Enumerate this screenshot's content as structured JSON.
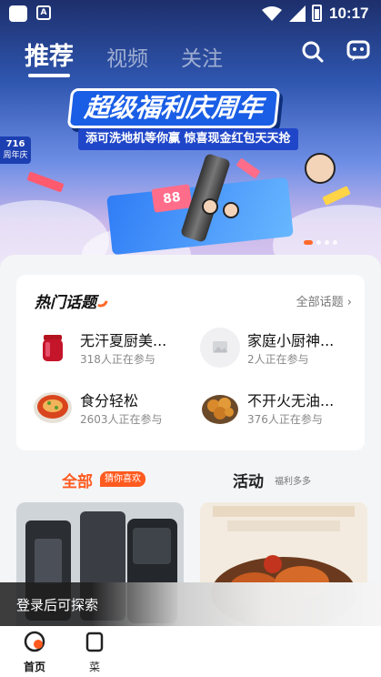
{
  "status_bar": {
    "time": "10:17",
    "app_badge": "A"
  },
  "header": {
    "tabs": [
      {
        "label": "推荐",
        "active": true
      },
      {
        "label": "视频",
        "active": false
      },
      {
        "label": "关注",
        "active": false
      }
    ],
    "search_icon": "search-icon",
    "message_icon": "chat-robot-icon"
  },
  "banner": {
    "title": "超级福利庆周年",
    "subtitle": "添可洗地机等你赢 惊喜现金红包天天抢",
    "badge": [
      "716",
      "周年庆"
    ],
    "card_text": "88"
  },
  "hot_topics": {
    "title": "热门话题",
    "more_label": "全部话题",
    "items": [
      {
        "name": "无汗夏厨美...",
        "count": "318人正在参与",
        "thumb": "jam-jar"
      },
      {
        "name": "家庭小厨神...",
        "count": "2人正在参与",
        "thumb": "image-placeholder"
      },
      {
        "name": "食分轻松",
        "count": "2603人正在参与",
        "thumb": "noodle-bowl"
      },
      {
        "name": "不开火无油...",
        "count": "376人正在参与",
        "thumb": "fried-food"
      }
    ]
  },
  "feed_tabs": {
    "all_label": "全部",
    "all_tag": "猜你喜欢",
    "activity_label": "活动",
    "activity_tag": "福利多多"
  },
  "toast": {
    "text": "登录后可探索"
  },
  "bottom_nav": [
    {
      "label": "首页",
      "icon": "home-icon",
      "active": true
    },
    {
      "label": "菜",
      "icon": "recipe-icon",
      "active": false
    }
  ],
  "colors": {
    "accent": "#ff5a1f",
    "banner_blue": "#1a5ee6"
  }
}
